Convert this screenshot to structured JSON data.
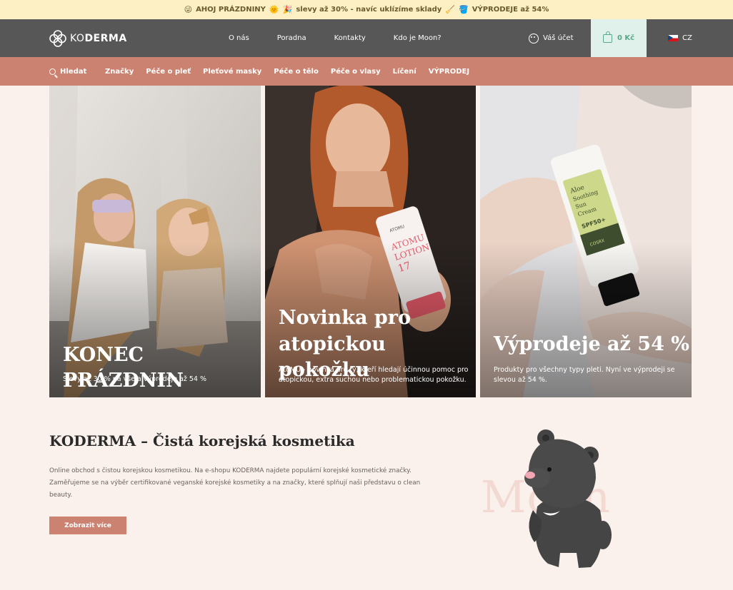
{
  "announcement": {
    "emoji_left": "😜",
    "part1": "AHOJ PRÁZDNINY",
    "emoji_sun": "🌞",
    "emoji_mid": "🎉",
    "part2": "slevy až 30% - navíc uklízíme sklady",
    "emoji_broom": "🧹",
    "emoji_bucket": "🪣",
    "part3": "VÝPRODEJE až 54%"
  },
  "header": {
    "logo_light": "KO",
    "logo_bold": "DERMA",
    "nav": [
      "O nás",
      "Poradna",
      "Kontakty",
      "Kdo je Moon?"
    ],
    "account_label": "Váš účet",
    "cart_label": "0 Kč",
    "lang_label": "CZ"
  },
  "catnav": {
    "search_label": "Hledat",
    "items": [
      "Značky",
      "Péče o pleť",
      "Pleťové masky",
      "Péče o tělo",
      "Péče o vlasy",
      "Líčení",
      "VÝPRODEJ"
    ]
  },
  "cards": [
    {
      "title": "KONEC PRÁZDNIN",
      "text": "Slevy až 30 % na vše a výprodeje až 54 %"
    },
    {
      "title_line1": "Novinka pro",
      "title_line2": "atopickou pokožku",
      "text_line1": "AtoMU - novinka pro ty, kteří hledají účinnou pomoc pro",
      "text_line2": "atopickou, extra suchou nebo problematickou pokožku.",
      "tube_brand": "ATOMU",
      "tube_line1": "ATOMU",
      "tube_line2": "LOTION",
      "tube_line3": "17"
    },
    {
      "title": "Výprodeje až 54 %",
      "text_line1": "Produkty pro všechny typy pleti. Nyní ve výprodeji se",
      "text_line2": "slevou až 54 %.",
      "tube_line1": "Aloe",
      "tube_line2": "Soothing",
      "tube_line3": "Sun",
      "tube_line4": "Cream",
      "tube_spf": "SPF50+",
      "tube_brand": "COSRX"
    }
  ],
  "intro": {
    "title": "KODERMA – Čistá korejská kosmetika",
    "text_line1": "Online obchod s čistou korejskou kosmetikou. Na e-shopu KODERMA najdete populární korejské kosmetické značky.",
    "text_line2": "Zaměřujeme se na výběr certifikované veganské korejské kosmetiky a na značky, které splňují naši představu o clean",
    "text_line3": "beauty.",
    "button_label": "Zobrazit více",
    "moon_word": "Moon"
  },
  "colors": {
    "announcement_bg": "#fdf0c4",
    "header_bg": "#575757",
    "accent": "#cb8271",
    "cart_bg": "#dff1ea",
    "page_bg": "#faf0ec"
  }
}
